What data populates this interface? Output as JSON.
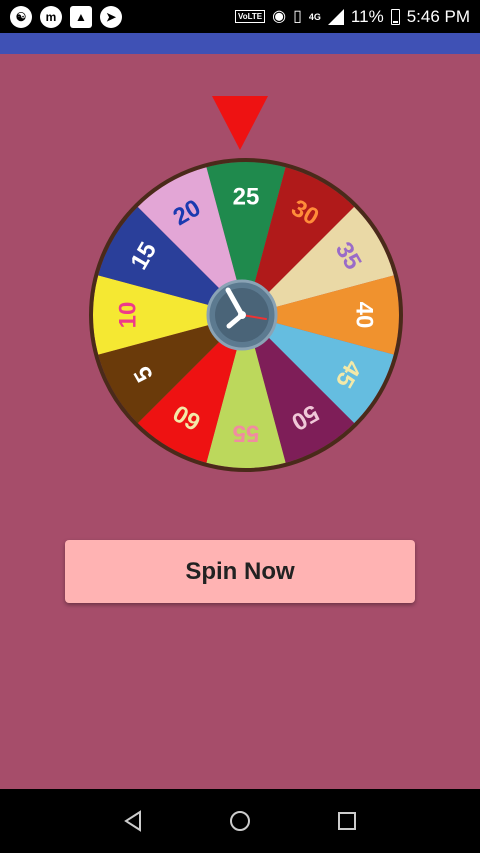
{
  "status_bar": {
    "network_label": "VoLTE",
    "data_type": "4G",
    "battery_level": "11%",
    "time": "5:46 PM",
    "app_icons": [
      "data-saver-icon",
      "messenger-m-icon",
      "gallery-icon",
      "telegram-icon"
    ]
  },
  "wheel": {
    "segments": [
      {
        "label": "25",
        "color": "#1f8a4d",
        "text_color": "#ffffff"
      },
      {
        "label": "30",
        "color": "#b01a1a",
        "text_color": "#ff8c3a"
      },
      {
        "label": "35",
        "color": "#ead9a6",
        "text_color": "#9a6bc8"
      },
      {
        "label": "40",
        "color": "#f0922e",
        "text_color": "#ffffff"
      },
      {
        "label": "45",
        "color": "#65bde0",
        "text_color": "#f3e9a8"
      },
      {
        "label": "50",
        "color": "#7e1e58",
        "text_color": "#f0c8d8"
      },
      {
        "label": "55",
        "color": "#bcd85c",
        "text_color": "#f08ca0"
      },
      {
        "label": "60",
        "color": "#ee1212",
        "text_color": "#f3e9a8"
      },
      {
        "label": "5",
        "color": "#6a3a0a",
        "text_color": "#ffffff"
      },
      {
        "label": "10",
        "color": "#f5e832",
        "text_color": "#ee3a8a"
      },
      {
        "label": "15",
        "color": "#2a3f9a",
        "text_color": "#ffffff"
      },
      {
        "label": "20",
        "color": "#e3a6d6",
        "text_color": "#1a3ab0"
      }
    ],
    "rim_color": "#4a2a1a",
    "pointer_color": "#ee1212",
    "center_icon": "clock-icon"
  },
  "spin_button": {
    "label": "Spin Now"
  },
  "nav_bar": {
    "back": "back-triangle-icon",
    "home": "home-circle-icon",
    "recents": "recents-square-icon"
  }
}
